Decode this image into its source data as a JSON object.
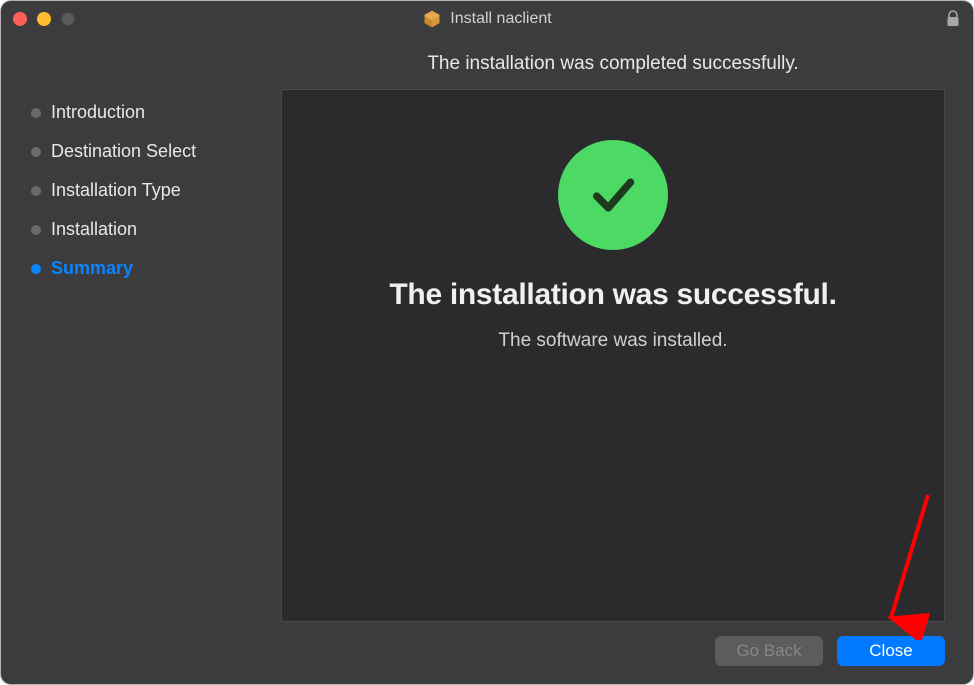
{
  "window": {
    "title": "Install naclient"
  },
  "header": {
    "text": "The installation was completed successfully."
  },
  "sidebar": {
    "items": [
      {
        "label": "Introduction",
        "active": false
      },
      {
        "label": "Destination Select",
        "active": false
      },
      {
        "label": "Installation Type",
        "active": false
      },
      {
        "label": "Installation",
        "active": false
      },
      {
        "label": "Summary",
        "active": true
      }
    ]
  },
  "panel": {
    "title": "The installation was successful.",
    "subtitle": "The software was installed."
  },
  "buttons": {
    "go_back": "Go Back",
    "close": "Close"
  }
}
